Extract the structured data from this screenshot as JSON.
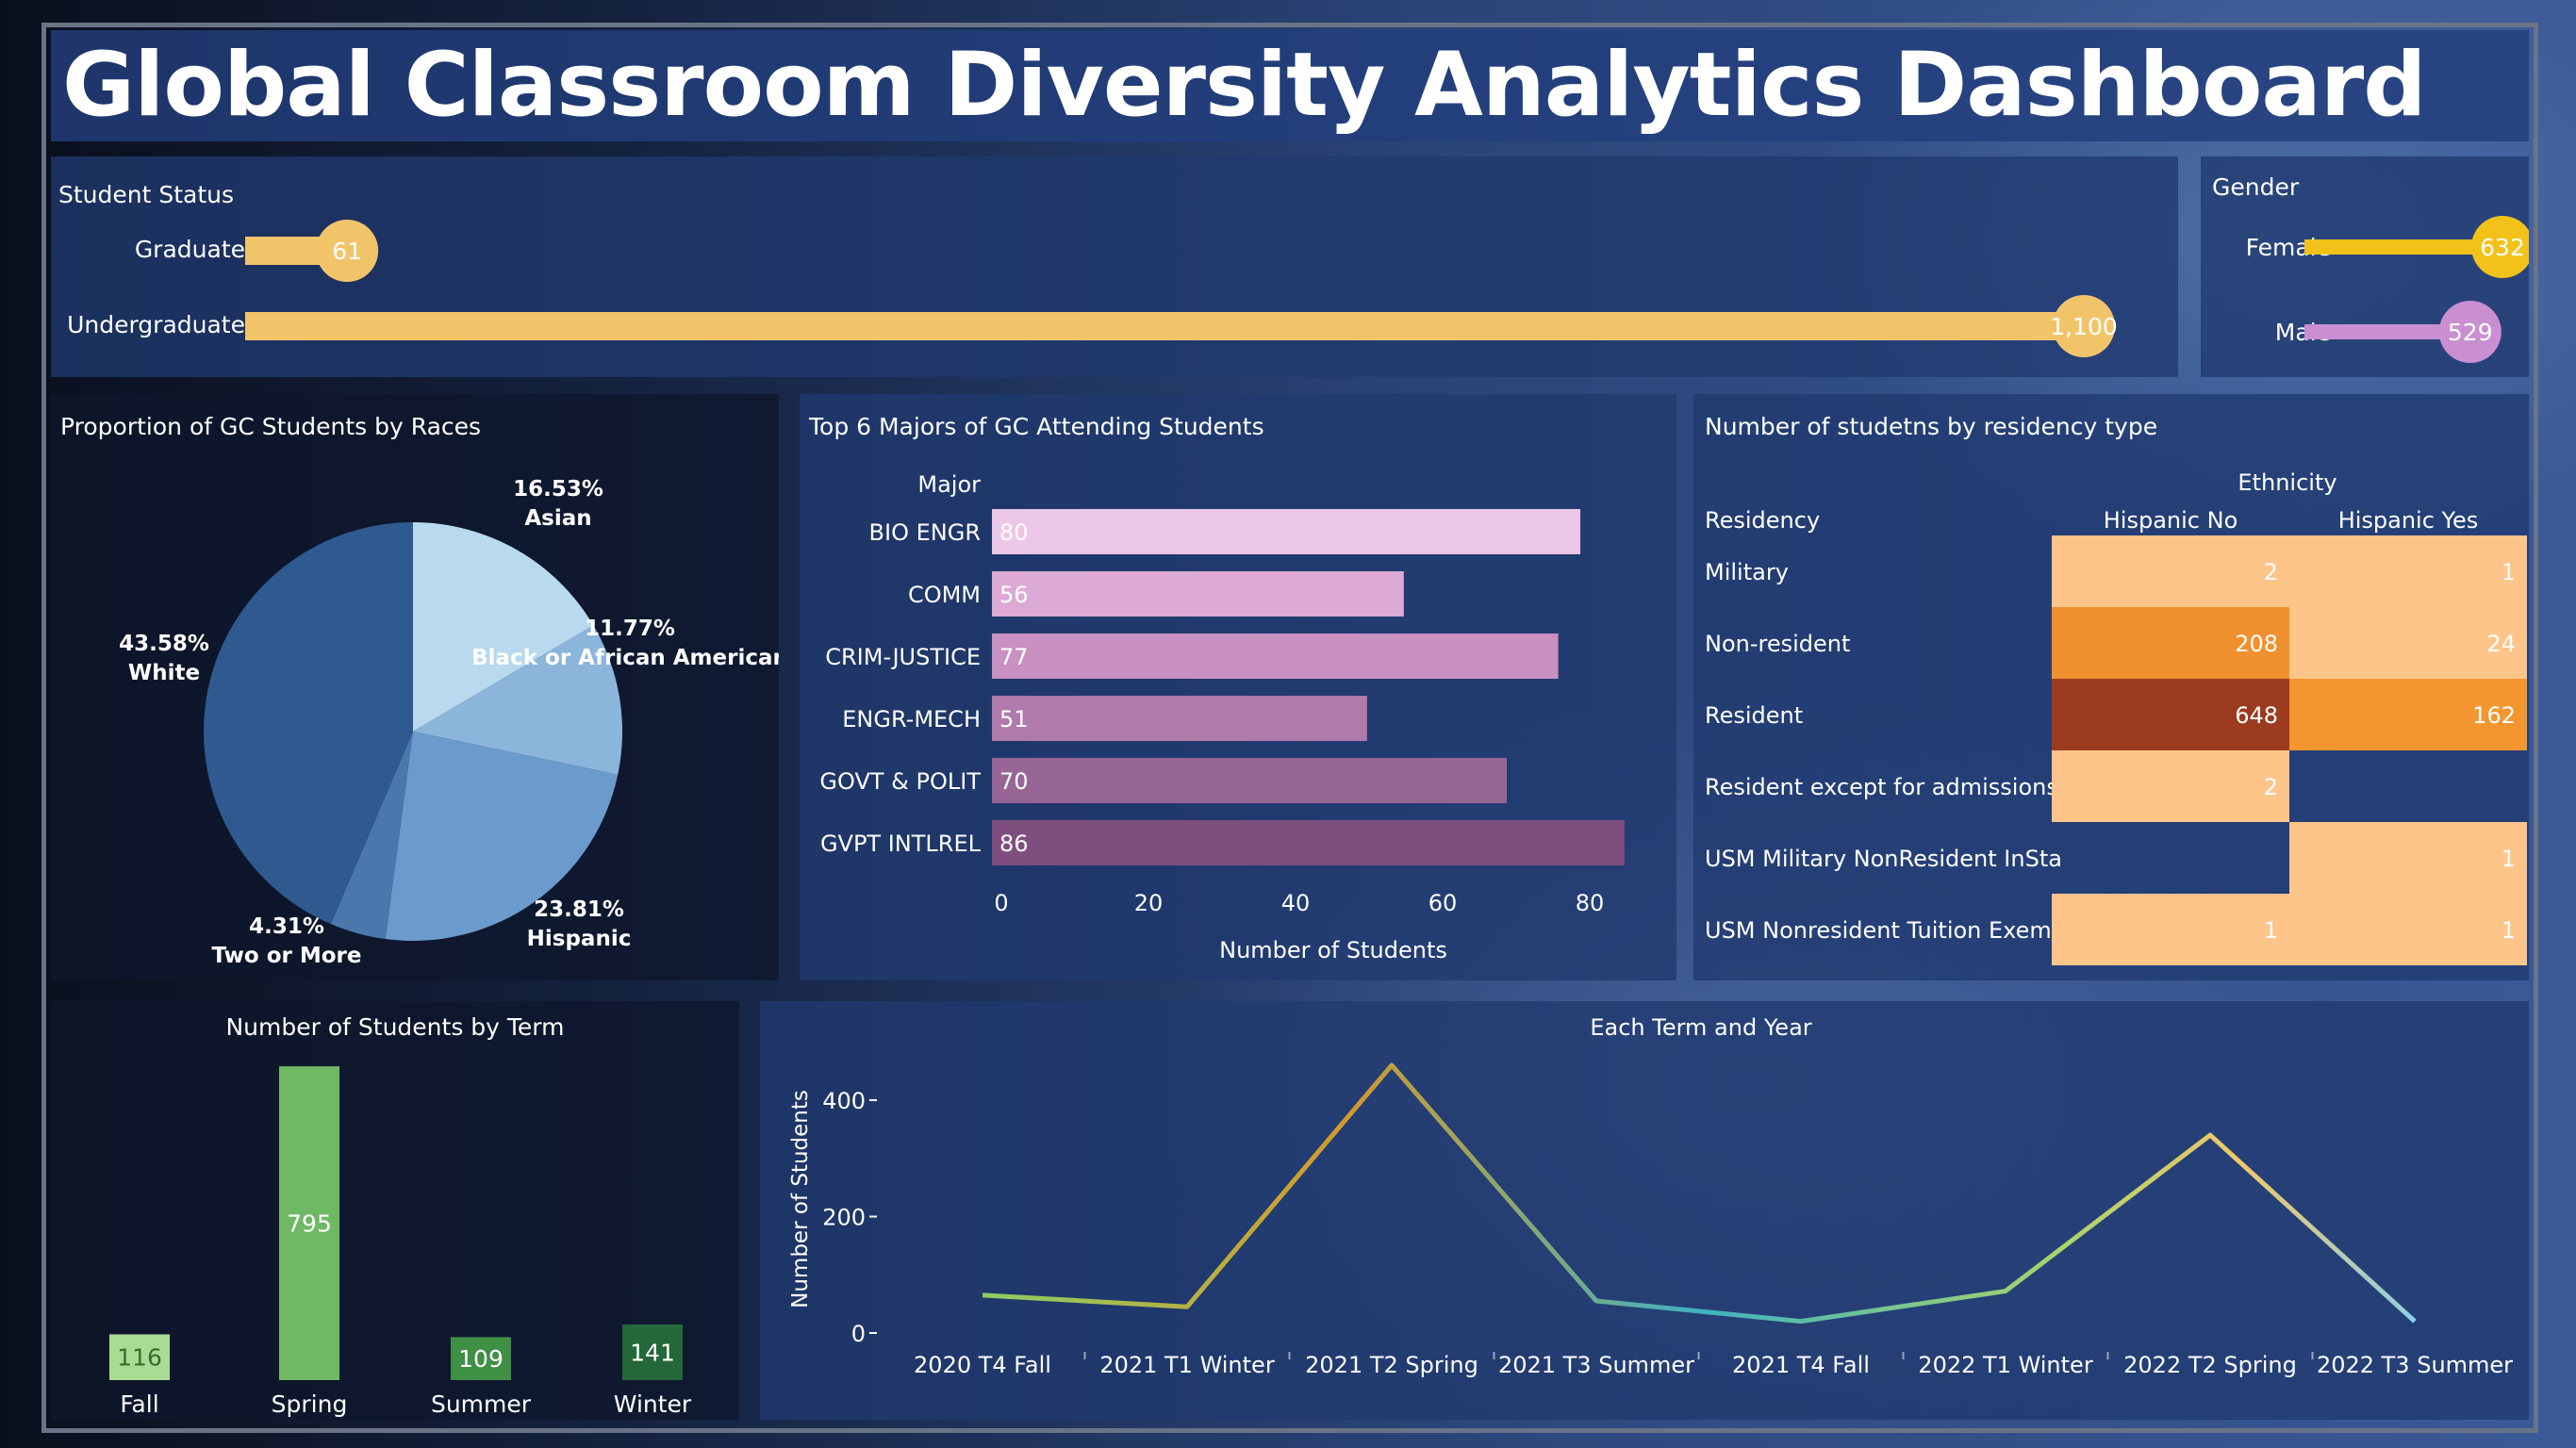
{
  "title": "Global Classroom Diversity Analytics Dashboard",
  "student_status": {
    "title": "Student Status",
    "items": [
      {
        "label": "Graduate",
        "value": 61,
        "display": "61"
      },
      {
        "label": "Undergraduate",
        "value": 1100,
        "display": "1,100"
      }
    ],
    "color": "#f2c46a"
  },
  "gender": {
    "title": "Gender",
    "items": [
      {
        "label": "Female",
        "value": 632,
        "display": "632",
        "color": "#f2c21a"
      },
      {
        "label": "Male",
        "value": 529,
        "display": "529",
        "color": "#c98fd1"
      }
    ]
  },
  "races": {
    "title": "Proportion of GC Students by Races",
    "slices": [
      {
        "name": "Asian",
        "pct": "16.53%",
        "value": 16.53,
        "color": "#b9d9ee"
      },
      {
        "name": "Black or African American",
        "pct": "11.77%",
        "value": 11.77,
        "color": "#8bb5db"
      },
      {
        "name": "Hispanic",
        "pct": "23.81%",
        "value": 23.81,
        "color": "#6b9bcc"
      },
      {
        "name": "Two or More",
        "pct": "4.31%",
        "value": 4.31,
        "color": "#4a78ad"
      },
      {
        "name": "White",
        "pct": "43.58%",
        "value": 43.58,
        "color": "#2e5a8f"
      }
    ]
  },
  "majors": {
    "title": "Top 6 Majors of GC Attending Students",
    "column_header": "Major",
    "xlabel": "Number of Students",
    "ticks": [
      "0",
      "20",
      "40",
      "60",
      "80"
    ],
    "xmax": 90,
    "bars": [
      {
        "label": "BIO ENGR",
        "value": 80,
        "color": "#ecc6e6"
      },
      {
        "label": "COMM",
        "value": 56,
        "color": "#dcaad4"
      },
      {
        "label": "CRIM-JUSTICE",
        "value": 77,
        "color": "#c990c2"
      },
      {
        "label": "ENGR-MECH",
        "value": 51,
        "color": "#b07aab"
      },
      {
        "label": "GOVT & POLIT",
        "value": 70,
        "color": "#976696"
      },
      {
        "label": "GVPT INTLREL",
        "value": 86,
        "color": "#7e4f7e"
      }
    ]
  },
  "residency": {
    "title": "Number of studetns by residency type",
    "row_header": "Residency",
    "col_group": "Ethnicity",
    "columns": [
      "Hispanic No",
      "Hispanic Yes"
    ],
    "rows": [
      {
        "label": "Military",
        "cells": [
          {
            "value": "2",
            "color": "#fdc58a"
          },
          {
            "value": "1",
            "color": "#fdc58a"
          }
        ]
      },
      {
        "label": "Non-resident",
        "cells": [
          {
            "value": "208",
            "color": "#f0902e"
          },
          {
            "value": "24",
            "color": "#fdc58a"
          }
        ]
      },
      {
        "label": "Resident",
        "cells": [
          {
            "value": "648",
            "color": "#9c3b1f"
          },
          {
            "value": "162",
            "color": "#f4962f"
          }
        ]
      },
      {
        "label": "Resident except for admissions",
        "cells": [
          {
            "value": "2",
            "color": "#fdc58a"
          },
          {
            "value": "",
            "color": ""
          }
        ]
      },
      {
        "label": "USM Military NonResident InSta",
        "cells": [
          {
            "value": "",
            "color": ""
          },
          {
            "value": "1",
            "color": "#fdc58a"
          }
        ]
      },
      {
        "label": "USM Nonresident Tuition Exempt",
        "cells": [
          {
            "value": "1",
            "color": "#fdc58a"
          },
          {
            "value": "1",
            "color": "#fdc58a"
          }
        ]
      }
    ]
  },
  "terms": {
    "title": "Number of Students by Term",
    "ymax": 800,
    "bars": [
      {
        "label": "Fall",
        "value": 116,
        "color": "#a8dc93",
        "text_color": "#3a6a30"
      },
      {
        "label": "Spring",
        "value": 795,
        "color": "#6fb864",
        "text_color": "#ffffff"
      },
      {
        "label": "Summer",
        "value": 109,
        "color": "#3f8f45",
        "text_color": "#ffffff"
      },
      {
        "label": "Winter",
        "value": 141,
        "color": "#24683a",
        "text_color": "#ffffff"
      }
    ]
  },
  "chart_data": [
    {
      "type": "line",
      "title": "Each Term and Year",
      "ylabel": "Number of Students",
      "xlabel": "",
      "ylim": [
        0,
        460
      ],
      "yticks": [
        "0",
        "200",
        "400"
      ],
      "x": [
        "2020 T4 Fall",
        "2021 T1 Winter",
        "2021 T2 Spring",
        "2021 T3 Summer",
        "2021 T4 Fall",
        "2022 T1 Winter",
        "2022 T2 Spring",
        "2022 T3 Summer"
      ],
      "series": [
        {
          "values": [
            65,
            45,
            460,
            55,
            20,
            72,
            340,
            20
          ]
        }
      ]
    }
  ]
}
